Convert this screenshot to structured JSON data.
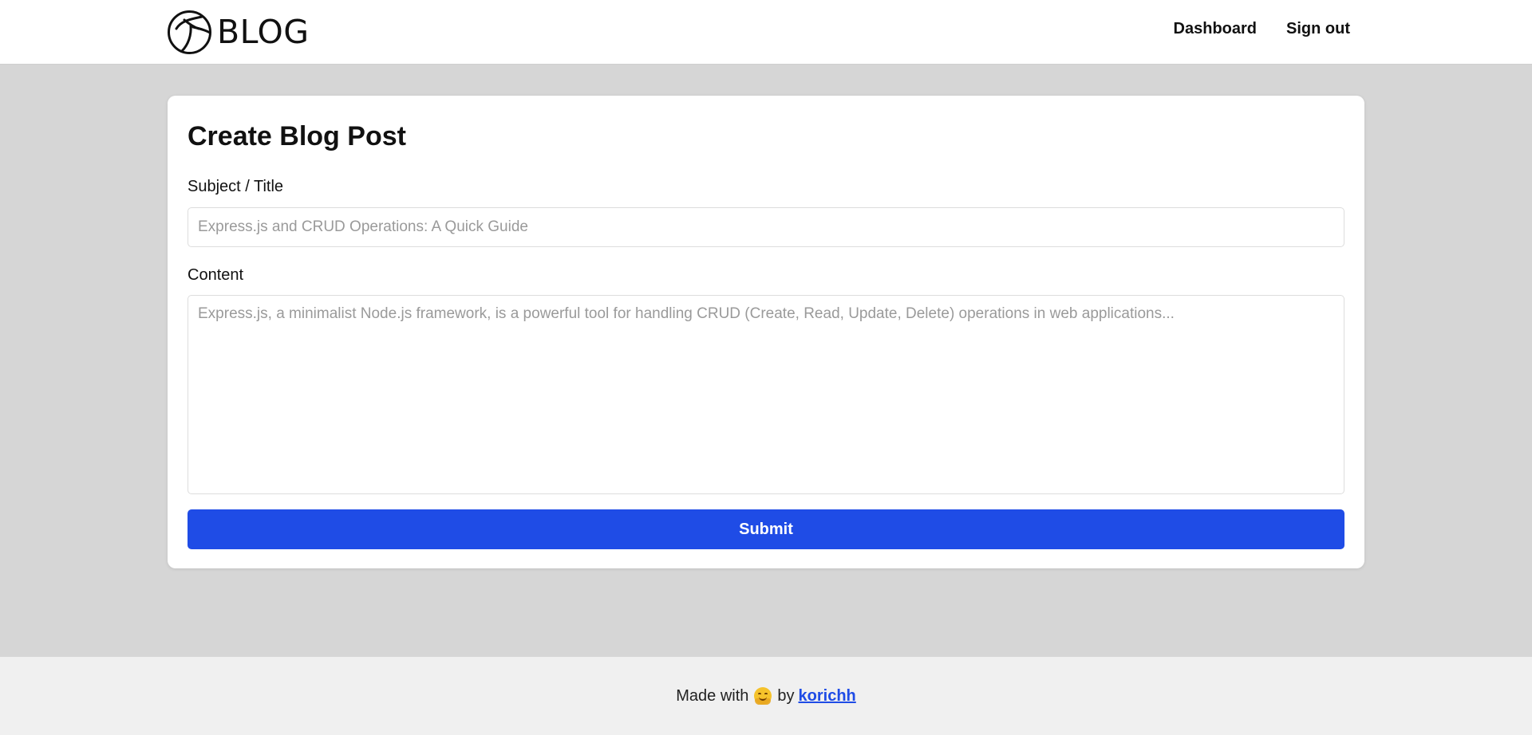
{
  "header": {
    "logo_text": "BLOG",
    "nav": {
      "dashboard": "Dashboard",
      "sign_out": "Sign out"
    }
  },
  "form": {
    "title": "Create Blog Post",
    "subject_label": "Subject / Title",
    "subject_placeholder": "Express.js and CRUD Operations: A Quick Guide",
    "content_label": "Content",
    "content_placeholder": "Express.js, a minimalist Node.js framework, is a powerful tool for handling CRUD (Create, Read, Update, Delete) operations in web applications...",
    "submit_label": "Submit"
  },
  "footer": {
    "made_with": "Made with",
    "emoji_icon": "hugging-face-emoji",
    "by": "by",
    "author": "korichh"
  },
  "colors": {
    "accent": "#1f4ce6",
    "page_bg": "#d6d6d6",
    "footer_bg": "#f0f0f0"
  }
}
